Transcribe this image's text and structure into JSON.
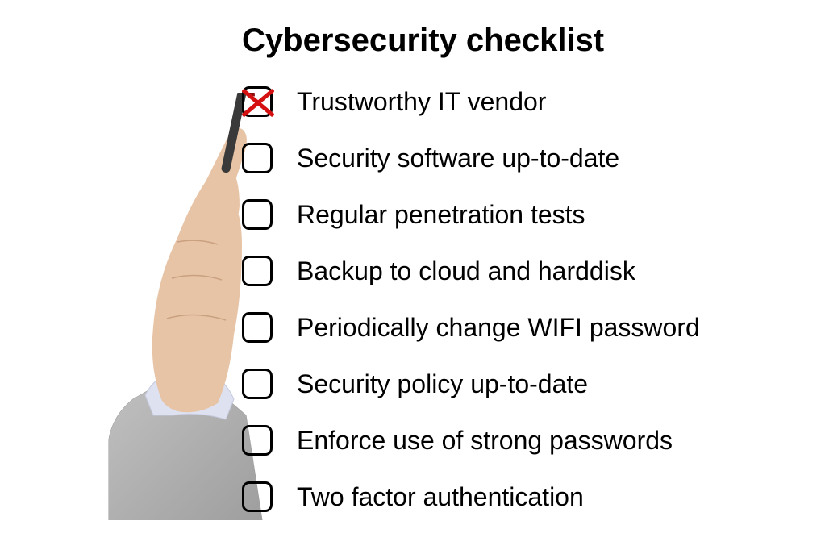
{
  "title": "Cybersecurity checklist",
  "items": [
    {
      "label": "Trustworthy IT vendor",
      "checked": true
    },
    {
      "label": "Security software up-to-date",
      "checked": false
    },
    {
      "label": "Regular penetration tests",
      "checked": false
    },
    {
      "label": "Backup to cloud and harddisk",
      "checked": false
    },
    {
      "label": "Periodically change WIFI password",
      "checked": false
    },
    {
      "label": "Security policy up-to-date",
      "checked": false
    },
    {
      "label": "Enforce use of strong passwords",
      "checked": false
    },
    {
      "label": "Two factor authentication",
      "checked": false
    }
  ],
  "colors": {
    "check_mark": "#d41010",
    "text": "#000000",
    "background": "#ffffff"
  }
}
